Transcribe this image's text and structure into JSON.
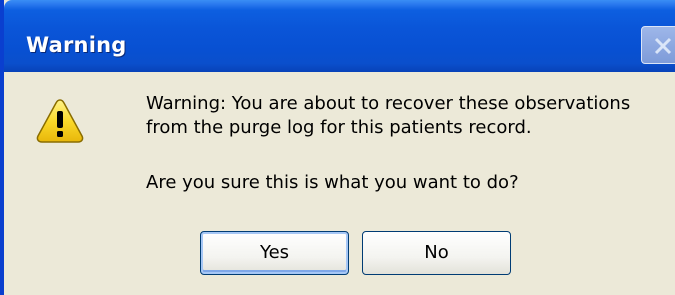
{
  "window": {
    "title": "Warning",
    "close_icon": "close-icon"
  },
  "message": {
    "icon": "warning-icon",
    "line1": "Warning: You are about to recover these observations",
    "line2": "from the purge log for this patients record.",
    "question": "Are you sure this is what you want to do?"
  },
  "buttons": {
    "yes_label": "Yes",
    "no_label": "No",
    "default": "Yes"
  },
  "colors": {
    "titlebar": "#0a55d8",
    "client_background": "#ece9d8",
    "warning_icon": "#f7d417"
  }
}
